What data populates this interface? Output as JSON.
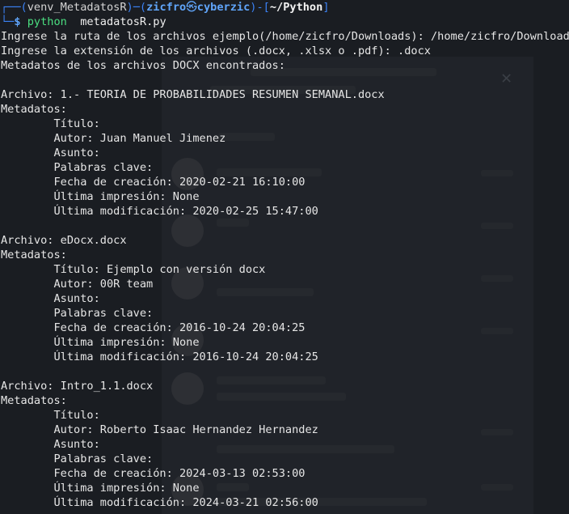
{
  "prompt": {
    "venv": "venv_MetadatosR",
    "user": "zicfro",
    "symbol": "㉿",
    "host": "cyberzic",
    "cwd": "~/Python",
    "dollar": "$",
    "command": "python",
    "argument": "metadatosR.py"
  },
  "output": {
    "input_path_line": "Ingrese la ruta de los archivos ejemplo(/home/zicfro/Downloads): /home/zicfro/Downloads",
    "input_ext_line": "Ingrese la extensión de los archivos (.docx, .xlsx o .pdf): .docx",
    "header_line": "Metadatos de los archivos DOCX encontrados:"
  },
  "files": [
    {
      "archivo": "Archivo: 1.- TEORIA DE PROBABILIDADES RESUMEN SEMANAL.docx",
      "metadatos": "Metadatos:",
      "titulo": "        Título:",
      "autor": "        Autor: Juan Manuel Jimenez",
      "asunto": "        Asunto:",
      "palabras": "        Palabras clave:",
      "creacion": "        Fecha de creación: 2020-02-21 16:10:00",
      "impresion": "        Última impresión: None",
      "modificacion": "        Última modificación: 2020-02-25 15:47:00"
    },
    {
      "archivo": "Archivo: eDocx.docx",
      "metadatos": "Metadatos:",
      "titulo": "        Título: Ejemplo con versión docx",
      "autor": "        Autor: 00R team",
      "asunto": "        Asunto:",
      "palabras": "        Palabras clave:",
      "creacion": "        Fecha de creación: 2016-10-24 20:04:25",
      "impresion": "        Última impresión: None",
      "modificacion": "        Última modificación: 2016-10-24 20:04:25"
    },
    {
      "archivo": "Archivo: Intro_1.1.docx",
      "metadatos": "Metadatos:",
      "titulo": "        Título:",
      "autor": "        Autor: Roberto Isaac Hernandez Hernandez",
      "asunto": "        Asunto:",
      "palabras": "        Palabras clave:",
      "creacion": "        Fecha de creación: 2024-03-13 02:53:00",
      "impresion": "        Última impresión: None",
      "modificacion": "        Última modificación: 2024-03-21 02:56:00"
    }
  ],
  "colors": {
    "background": "#1a1d22",
    "prompt_accent": "#3b82f6",
    "command": "#4ade80",
    "text": "#e6e6e6"
  }
}
